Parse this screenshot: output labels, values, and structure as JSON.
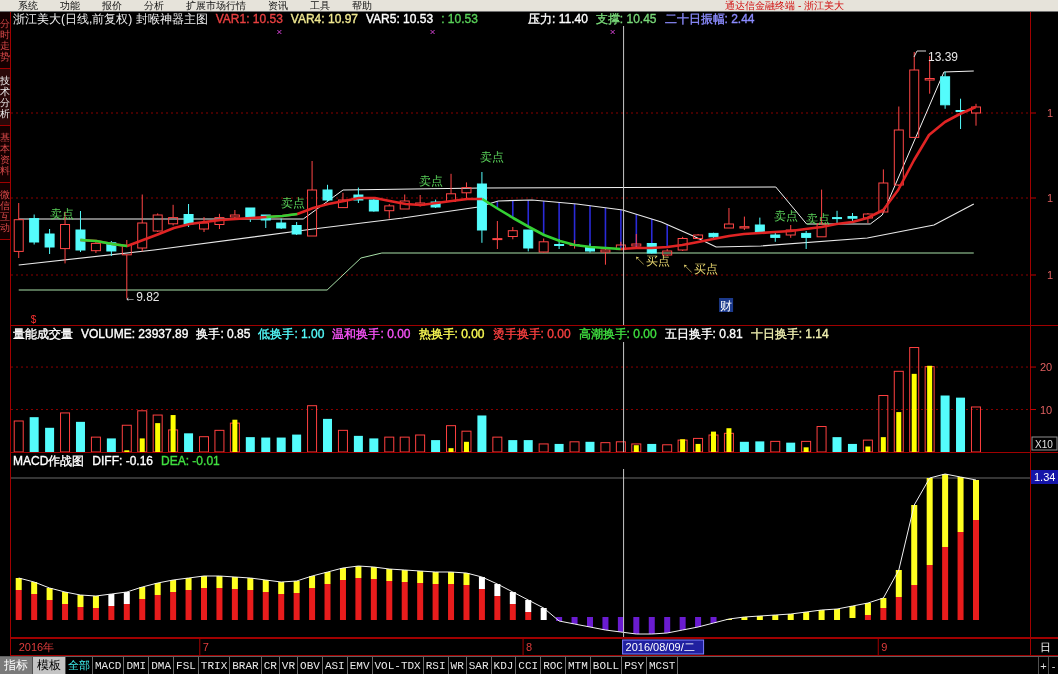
{
  "menu_bar": {
    "items": [
      "系统",
      "功能",
      "报价",
      "分析",
      "扩展市场行情",
      "资讯",
      "工具",
      "帮助"
    ],
    "title": "通达信金融终端 - 浙江美大"
  },
  "side_tabs": [
    {
      "label": "分时走势",
      "selected": false
    },
    {
      "label": "技术分析",
      "selected": true
    },
    {
      "label": "基本资料",
      "selected": false
    },
    {
      "label": "微信互动",
      "selected": false
    }
  ],
  "main_chart": {
    "title": "浙江美大(日线,前复权) 封喉神器主图",
    "indicators": [
      {
        "text": "VAR1: 10.53",
        "color": "#e84040"
      },
      {
        "text": "VAR4: 10.97",
        "color": "#f0e890"
      },
      {
        "text": "VAR5: 10.53",
        "color": "#ffffff"
      },
      {
        "text": ": 10.53",
        "color": "#58d058"
      }
    ],
    "levels": [
      {
        "text": "压力: 11.40",
        "color": "#ffffff"
      },
      {
        "text": "支撑: 10.45",
        "color": "#78d878"
      },
      {
        "text": "二十日振幅: 2.44",
        "color": "#8c8cff"
      }
    ],
    "annotations": [
      {
        "text": "13.39",
        "kind": "high"
      },
      {
        "text": "卖点",
        "kind": "sell"
      },
      {
        "text": "卖点",
        "kind": "sell"
      },
      {
        "text": "卖点",
        "kind": "sell"
      },
      {
        "text": "卖点",
        "kind": "sell"
      },
      {
        "text": "卖点",
        "kind": "sell"
      },
      {
        "text": "卖点",
        "kind": "sell"
      },
      {
        "text": "↖买点",
        "kind": "buy"
      },
      {
        "text": "↖买点",
        "kind": "buy"
      },
      {
        "text": "←9.82",
        "kind": "low"
      },
      {
        "text": "财",
        "kind": "event"
      },
      {
        "text": "$",
        "kind": "marker"
      }
    ],
    "axis_labels": [
      "1",
      "1",
      "1"
    ]
  },
  "volume_chart": {
    "legend": [
      {
        "text": "量能成交量",
        "color": "#ffffff"
      },
      {
        "text": "VOLUME: 23937.89",
        "color": "#ffffff"
      },
      {
        "text": "换手: 0.85",
        "color": "#ffffff"
      },
      {
        "text": "低换手: 1.00",
        "color": "#54fcfc"
      },
      {
        "text": "温和换手: 0.00",
        "color": "#fc54fc"
      },
      {
        "text": "热换手: 0.00",
        "color": "#fcfc54"
      },
      {
        "text": "烫手换手: 0.00",
        "color": "#fc4040"
      },
      {
        "text": "高潮换手: 0.00",
        "color": "#40e040"
      },
      {
        "text": "五日换手: 0.81",
        "color": "#ffffff"
      },
      {
        "text": "十日换手: 1.14",
        "color": "#f0f0b0"
      }
    ],
    "scale": "X10",
    "chart_data": {
      "type": "bar",
      "categories": [
        null,
        null,
        null,
        null,
        null,
        null,
        null,
        null,
        null,
        null,
        null,
        null,
        null,
        null,
        null,
        null,
        null,
        null,
        null,
        null,
        null,
        null,
        null,
        null,
        null,
        null,
        null,
        null,
        null,
        null,
        null,
        null,
        null,
        null,
        null,
        null,
        null,
        null,
        null,
        null,
        null,
        null,
        null,
        null,
        null,
        null,
        null,
        null,
        null,
        null,
        null,
        null,
        null,
        null,
        null,
        null,
        null,
        null,
        null,
        null,
        null,
        null,
        null,
        null,
        null,
        null
      ],
      "ylim": [
        0,
        25.9
      ],
      "yticks": [
        10,
        20
      ],
      "series": [
        {
          "color": "#ff4040",
          "values": [
            7.3,
            null,
            null,
            9.2,
            null,
            3.5,
            null,
            6.3,
            9.7,
            8.7,
            5.2,
            null,
            3.6,
            5.1,
            6.8,
            null,
            null,
            null,
            null,
            10.9,
            null,
            5.1,
            null,
            null,
            3.5,
            3.5,
            4.0,
            null,
            6.2,
            4.9,
            null,
            3.5,
            null,
            null,
            1.9,
            null,
            2.4,
            null,
            2.2,
            2.4,
            1.9,
            null,
            1.7,
            2.8,
            3.2,
            4.0,
            4.4,
            null,
            null,
            2.5,
            null,
            2.5,
            6.0,
            null,
            null,
            2.8,
            13.3,
            19.0,
            24.6,
            20.1,
            null,
            null,
            10.6,
            null,
            null,
            null
          ]
        },
        {
          "color": "#54fcfc",
          "values": [
            null,
            8.2,
            5.7,
            null,
            7.1,
            null,
            3.2,
            null,
            null,
            null,
            null,
            4.4,
            null,
            null,
            null,
            3.5,
            3.4,
            3.4,
            4.1,
            null,
            7.8,
            null,
            3.8,
            3.2,
            null,
            null,
            null,
            2.8,
            null,
            null,
            8.6,
            null,
            2.8,
            2.8,
            null,
            1.9,
            null,
            2.4,
            null,
            null,
            null,
            1.9,
            null,
            null,
            null,
            null,
            null,
            2.4,
            2.5,
            null,
            2.2,
            null,
            null,
            3.5,
            1.9,
            null,
            null,
            null,
            null,
            null,
            13.3,
            12.8,
            null,
            null,
            null,
            null
          ]
        },
        {
          "color": "#ffff00",
          "values": [
            null,
            null,
            null,
            null,
            null,
            null,
            null,
            0.4,
            3.2,
            6.8,
            8.7,
            null,
            null,
            null,
            7.6,
            null,
            null,
            null,
            null,
            null,
            null,
            null,
            null,
            null,
            null,
            null,
            null,
            null,
            0.9,
            2.4,
            null,
            null,
            null,
            null,
            null,
            null,
            null,
            null,
            null,
            null,
            1.6,
            null,
            null,
            3.0,
            1.9,
            4.8,
            5.6,
            null,
            null,
            null,
            null,
            1.1,
            null,
            null,
            null,
            1.3,
            3.5,
            9.4,
            18.4,
            20.3,
            null,
            null,
            null,
            null,
            null,
            null
          ]
        }
      ]
    }
  },
  "macd_chart": {
    "legend": [
      {
        "text": "MACD作战图",
        "color": "#ffffff"
      },
      {
        "text": "DIFF: -0.16",
        "color": "#ffffff"
      },
      {
        "text": "DEA: -0.01",
        "color": "#40e040"
      }
    ],
    "axis_label": "1.34"
  },
  "date_axis": {
    "labels": [
      {
        "text": "2016年",
        "kind": "year"
      },
      {
        "text": "7",
        "kind": "month"
      },
      {
        "text": "8",
        "kind": "month"
      },
      {
        "text": "2016/08/09/二",
        "kind": "cursor"
      },
      {
        "text": "9",
        "kind": "month"
      }
    ],
    "period": "日"
  },
  "bottom_bar": {
    "modes": [
      {
        "label": "指标",
        "selected": true
      },
      {
        "label": "模板",
        "selected": false
      }
    ],
    "tabs": [
      {
        "label": "全部",
        "selected": true
      },
      {
        "label": "MACD",
        "selected": false
      },
      {
        "label": "DMI",
        "selected": false
      },
      {
        "label": "DMA",
        "selected": false
      },
      {
        "label": "FSL",
        "selected": false
      },
      {
        "label": "TRIX",
        "selected": false
      },
      {
        "label": "BRAR",
        "selected": false
      },
      {
        "label": "CR",
        "selected": false
      },
      {
        "label": "VR",
        "selected": false
      },
      {
        "label": "OBV",
        "selected": false
      },
      {
        "label": "ASI",
        "selected": false
      },
      {
        "label": "EMV",
        "selected": false
      },
      {
        "label": "VOL-TDX",
        "selected": false
      },
      {
        "label": "RSI",
        "selected": false
      },
      {
        "label": "WR",
        "selected": false
      },
      {
        "label": "SAR",
        "selected": false
      },
      {
        "label": "KDJ",
        "selected": false
      },
      {
        "label": "CCI",
        "selected": false
      },
      {
        "label": "ROC",
        "selected": false
      },
      {
        "label": "MTM",
        "selected": false
      },
      {
        "label": "BOLL",
        "selected": false
      },
      {
        "label": "PSY",
        "selected": false
      },
      {
        "label": "MCST",
        "selected": false
      }
    ],
    "buttons": [
      "+",
      "-"
    ]
  }
}
